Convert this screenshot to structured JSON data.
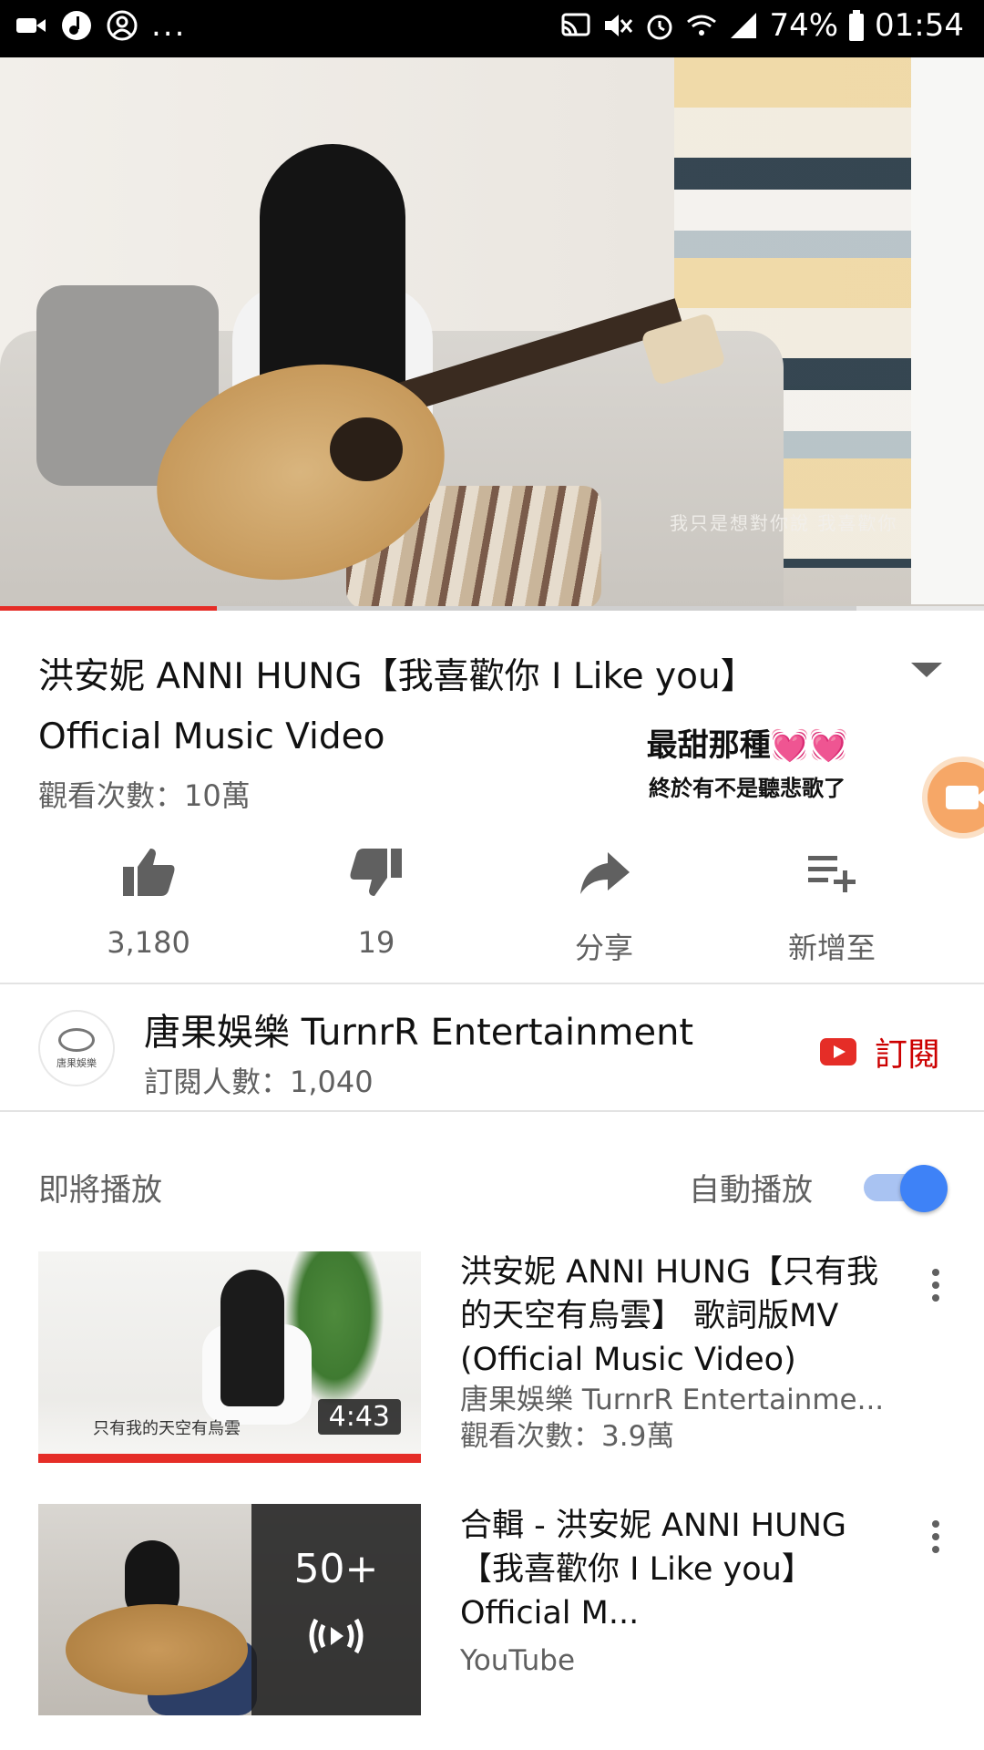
{
  "status_bar": {
    "battery": "74%",
    "time": "01:54",
    "left_icons": [
      "video-camera-icon",
      "music-note-icon",
      "account-circle-icon"
    ],
    "overflow": "...",
    "right_icons": [
      "cast-icon",
      "mute-icon",
      "alarm-icon",
      "wifi-icon",
      "signal-icon",
      "battery-icon"
    ]
  },
  "player": {
    "lyric_overlay": "我只是想對你說  我喜歡你",
    "progress_percent": 22,
    "buffer_percent": 87
  },
  "video": {
    "title": "洪安妮 ANNI HUNG【我喜歡你 I Like you】 Official Music Video",
    "views": "觀看次數：10萬"
  },
  "sticker": {
    "line1": "最甜那種",
    "line2": "終於有不是聽悲歌了",
    "hearts": "💓💓"
  },
  "actions": {
    "like_count": "3,180",
    "dislike_count": "19",
    "share_label": "分享",
    "add_label": "新增至"
  },
  "channel": {
    "name": "唐果娛樂 TurnrR Entertainment",
    "subscribers": "訂閱人數：1,040",
    "subscribe_label": "訂閱",
    "avatar_text": "唐果娛樂"
  },
  "up_next": {
    "header": "即將播放",
    "autoplay_label": "自動播放",
    "autoplay_on": true,
    "items": [
      {
        "title": "洪安妮 ANNI HUNG【只有我的天空有烏雲】 歌詞版MV (Official Music Video)",
        "channel": "唐果娛樂 TurnrR Entertainme...",
        "views": "觀看次數：3.9萬",
        "duration": "4:43",
        "thumb_caption": "只有我的天空有烏雲"
      },
      {
        "title": "合輯 - 洪安妮 ANNI HUNG【我喜歡你 I Like you】Official M...",
        "channel": "YouTube",
        "playlist_count": "50+"
      }
    ]
  },
  "colors": {
    "brand_red": "#e52d27",
    "subscribe_red": "#cc0000",
    "toggle_blue": "#3e82f7",
    "secondary_text": "#606060"
  }
}
